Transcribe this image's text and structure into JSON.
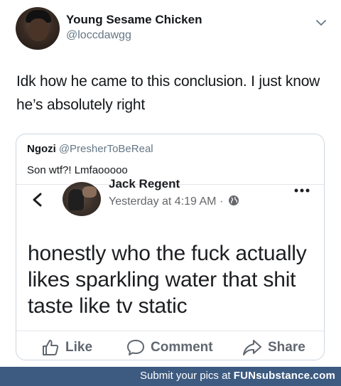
{
  "tweet": {
    "display_name": "Young Sesame Chicken",
    "handle": "@loccdawgg",
    "text": "Idk how he came to this conclusion. I just know he’s absolutely right",
    "menu_icon": "chevron-down-icon"
  },
  "quote": {
    "name": "Ngozi",
    "handle": "@PresherToBeReal",
    "text": "Son wtf?! Lmfaooooo"
  },
  "fb_post": {
    "author": "Jack Regent",
    "timestamp": "Yesterday at 4:19 AM · ",
    "privacy_icon": "globe-icon",
    "text": "honestly who the fuck actually likes sparkling water that shit taste like tv static",
    "actions": {
      "like": "Like",
      "comment": "Comment",
      "share": "Share"
    }
  },
  "footer": {
    "prefix": "Submit your pics at ",
    "brand": "FUNsubstance.com"
  },
  "colors": {
    "link_gray": "#657786",
    "fb_gray": "#606770",
    "footer_bg": "#3d5a80"
  }
}
